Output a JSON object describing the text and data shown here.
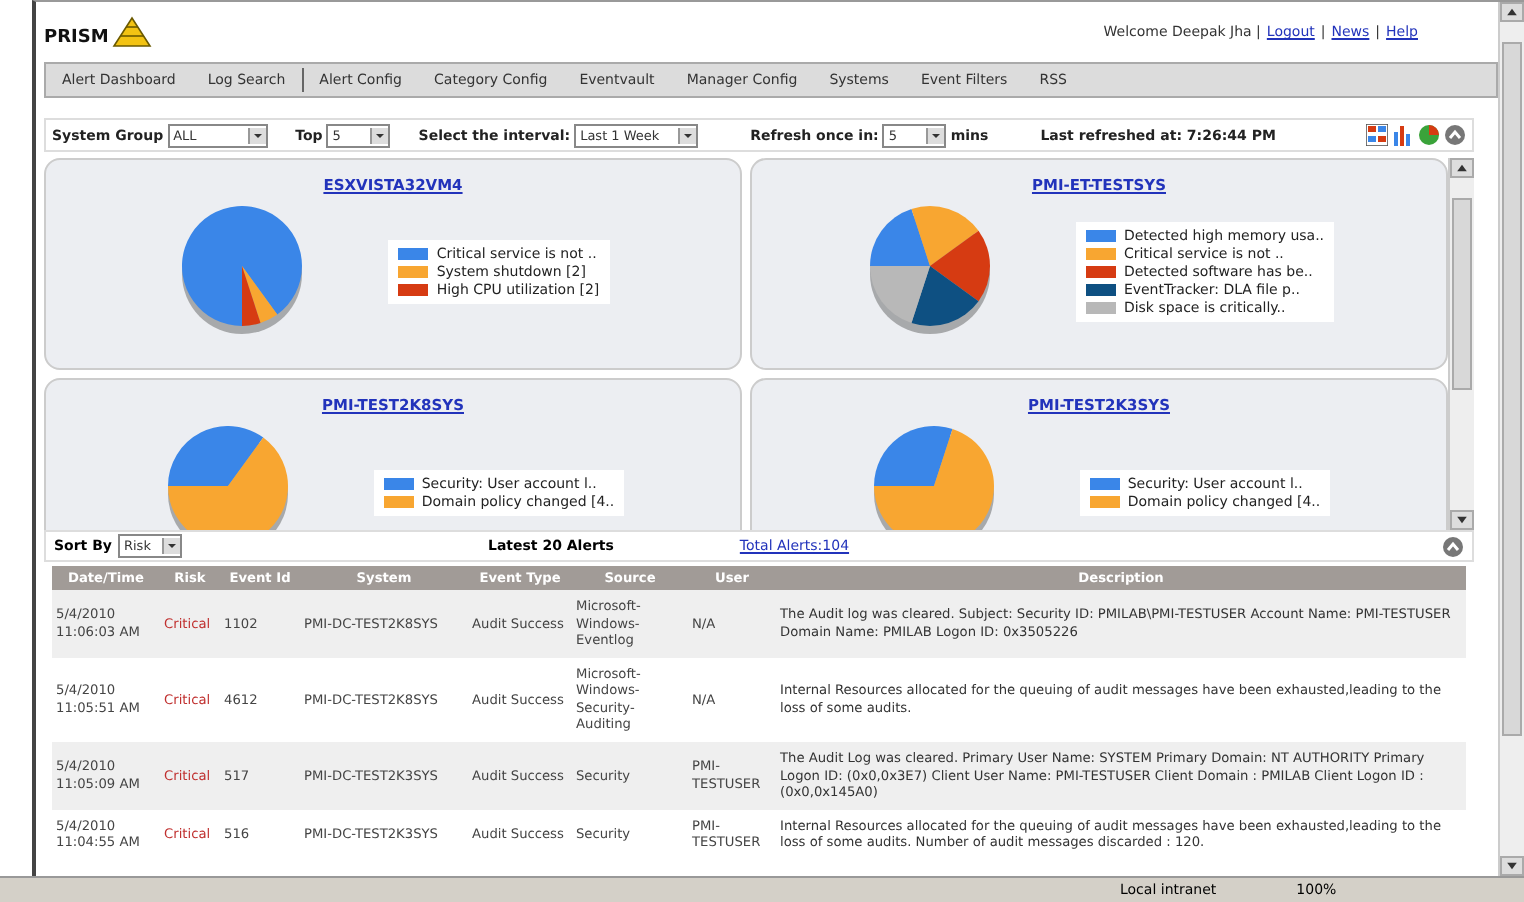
{
  "header": {
    "logo": "PRISM",
    "user_links": [
      {
        "kind": "text",
        "text": "Welcome Deepak Jha |"
      },
      {
        "kind": "link",
        "text": "Logout"
      },
      {
        "kind": "text",
        "text": "|"
      },
      {
        "kind": "link",
        "text": "News"
      },
      {
        "kind": "text",
        "text": "|"
      },
      {
        "kind": "link",
        "text": "Help"
      }
    ]
  },
  "nav": [
    "Alert Dashboard",
    "Log Search",
    "Alert Config",
    "Category Config",
    "Eventvault",
    "Manager Config",
    "Systems",
    "Event Filters",
    "RSS"
  ],
  "toolbar": {
    "system_group": {
      "label": "System Group",
      "value": "ALL"
    },
    "top": {
      "label": "Top",
      "value": "5"
    },
    "interval": {
      "label": "Select the interval:",
      "value": "Last 1 Week"
    },
    "refresh": {
      "label": "Refresh once in:",
      "value": "5",
      "unit": "mins"
    },
    "last_refreshed": "Last refreshed at: 7:26:44 PM"
  },
  "panels": [
    {
      "title": "ESXVISTA32VM4",
      "legend": [
        {
          "label": "Critical service is not ..",
          "color": "#3a86e8"
        },
        {
          "label": "System shutdown [2]",
          "color": "#f8a631"
        },
        {
          "label": "High CPU utilization [2]",
          "color": "#d63b12"
        }
      ]
    },
    {
      "title": "PMI-ET-TESTSYS",
      "legend": [
        {
          "label": "Detected high memory usa..",
          "color": "#3a86e8"
        },
        {
          "label": "Critical service is not ..",
          "color": "#f8a631"
        },
        {
          "label": "Detected software has be..",
          "color": "#d63b12"
        },
        {
          "label": "EventTracker: DLA file p..",
          "color": "#0e5082"
        },
        {
          "label": "Disk space is critically..",
          "color": "#b8b8b8"
        }
      ]
    },
    {
      "title": "PMI-TEST2K8SYS",
      "legend": [
        {
          "label": "Security: User account l..",
          "color": "#3a86e8"
        },
        {
          "label": "Domain policy changed [4..",
          "color": "#f8a631"
        }
      ]
    },
    {
      "title": "PMI-TEST2K3SYS",
      "legend": [
        {
          "label": "Security: User account l..",
          "color": "#3a86e8"
        },
        {
          "label": "Domain policy changed [4..",
          "color": "#f8a631"
        }
      ]
    }
  ],
  "alerts": {
    "sort_label": "Sort By",
    "sort_value": "Risk",
    "title": "Latest 20 Alerts",
    "total": "Total Alerts:104",
    "columns": [
      "Date/Time",
      "Risk",
      "Event Id",
      "System",
      "Event Type",
      "Source",
      "User",
      "Description"
    ],
    "rows": [
      {
        "date": "5/4/2010 11:06:03 AM",
        "risk": "Critical",
        "event_id": "1102",
        "system": "PMI-DC-TEST2K8SYS",
        "event_type": "Audit Success",
        "source": "Microsoft-Windows-Eventlog",
        "user": "N/A",
        "description": "The Audit log was cleared. Subject: Security ID: PMILAB\\PMI-TESTUSER Account Name: PMI-TESTUSER Domain Name: PMILAB Logon ID: 0x3505226"
      },
      {
        "date": "5/4/2010 11:05:51 AM",
        "risk": "Critical",
        "event_id": "4612",
        "system": "PMI-DC-TEST2K8SYS",
        "event_type": "Audit Success",
        "source": "Microsoft-Windows-Security-Auditing",
        "user": "N/A",
        "description": "Internal Resources allocated for the queuing of audit messages have been exhausted,leading to the loss of some audits."
      },
      {
        "date": "5/4/2010 11:05:09 AM",
        "risk": "Critical",
        "event_id": "517",
        "system": "PMI-DC-TEST2K3SYS",
        "event_type": "Audit Success",
        "source": "Security",
        "user": "PMI-TESTUSER",
        "description": "The Audit Log was cleared. Primary User Name: SYSTEM Primary Domain: NT AUTHORITY Primary Logon ID: (0x0,0x3E7) Client User Name: PMI-TESTUSER Client Domain : PMILAB Client Logon ID : (0x0,0x145A0)"
      },
      {
        "date": "5/4/2010 11:04:55 AM",
        "risk": "Critical",
        "event_id": "516",
        "system": "PMI-DC-TEST2K3SYS",
        "event_type": "Audit Success",
        "source": "Security",
        "user": "PMI-TESTUSER",
        "description": "Internal Resources allocated for the queuing of audit messages have been exhausted,leading to the loss of some audits. Number of audit messages discarded : 120."
      }
    ]
  },
  "status_bar": {
    "zone": "Local intranet",
    "zoom": "100%"
  }
}
